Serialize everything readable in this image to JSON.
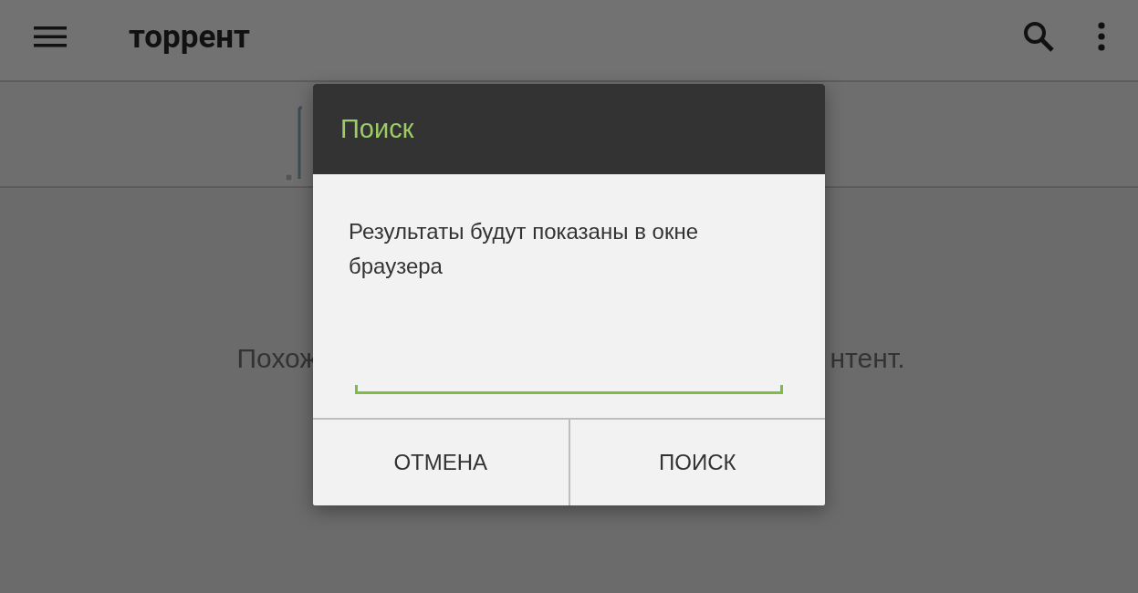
{
  "toolbar": {
    "title": "торрент"
  },
  "background_message": {
    "visible_start": "Похож",
    "visible_end": "нтент."
  },
  "dialog": {
    "title": "Поиск",
    "message": "Результаты будут показаны в окне браузера",
    "input": {
      "focused": true
    },
    "buttons": [
      {
        "label": "ОТМЕНА"
      },
      {
        "label": "ПОИСК"
      }
    ]
  }
}
